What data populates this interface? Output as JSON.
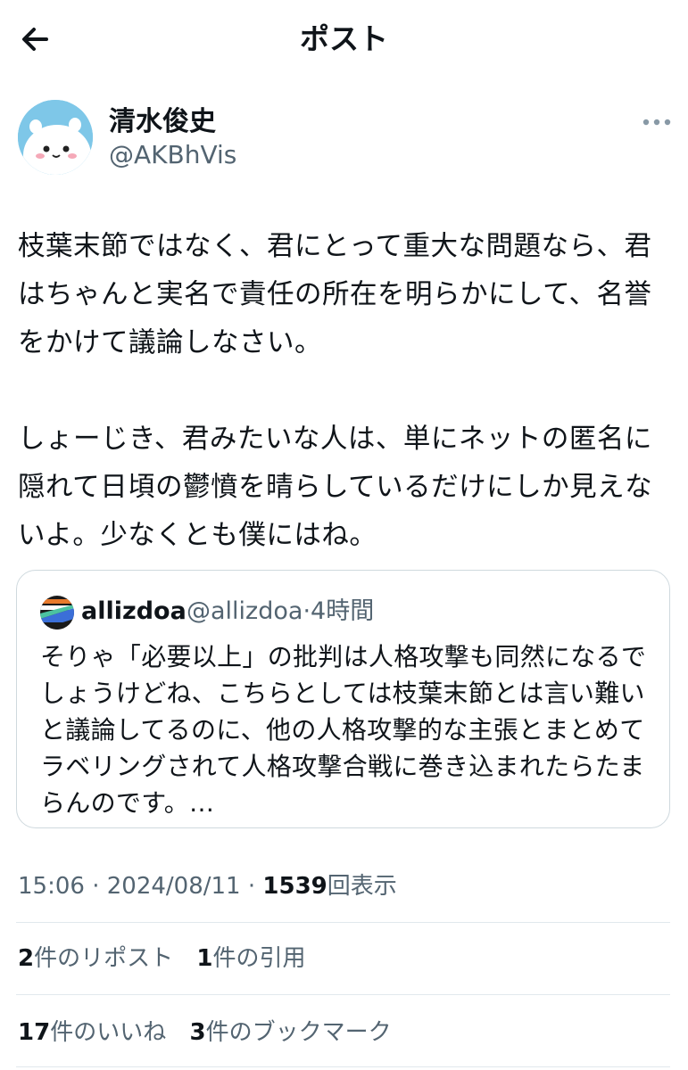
{
  "header": {
    "title": "ポスト"
  },
  "author": {
    "name": "清水俊史",
    "handle": "@AKBhVis"
  },
  "post": {
    "text": "枝葉末節ではなく、君にとって重大な問題なら、君\nはちゃんと実名で責任の所在を明らかにして、名誉\nをかけて議論しなさい。\n\nしょーじき、君みたいな人は、単にネットの匿名に\n隠れて日頃の鬱憤を晴らしているだけにしか見えな\nいよ。少なくとも僕にはね。"
  },
  "quote": {
    "name": "allizdoa",
    "handle": "@allizdoa",
    "separator": "·",
    "time": "4時間",
    "text": "そりゃ「必要以上」の批判は人格攻撃も同然になるで\nしょうけどね、こちらとしては枝葉末節とは言い難い\nと議論してるのに、他の人格攻撃的な主張とまとめて\nラベリングされて人格攻撃合戦に巻き込まれたらたま\nらんのです。…"
  },
  "meta": {
    "time": "15:06",
    "sep1": "·",
    "date": "2024/08/11",
    "sep2": "·",
    "views": "1539",
    "views_label": "回表示"
  },
  "stats": {
    "reposts": {
      "count": "2",
      "label": "件のリポスト"
    },
    "quotes": {
      "count": "1",
      "label": "件の引用"
    },
    "likes": {
      "count": "17",
      "label": "件のいいね"
    },
    "bookmarks": {
      "count": "3",
      "label": "件のブックマーク"
    }
  },
  "icons": {
    "back": "arrow-left-icon",
    "more": "more-horizontal-icon"
  },
  "colors": {
    "text": "#0f1419",
    "secondary": "#536471",
    "border": "#cfd9de"
  }
}
